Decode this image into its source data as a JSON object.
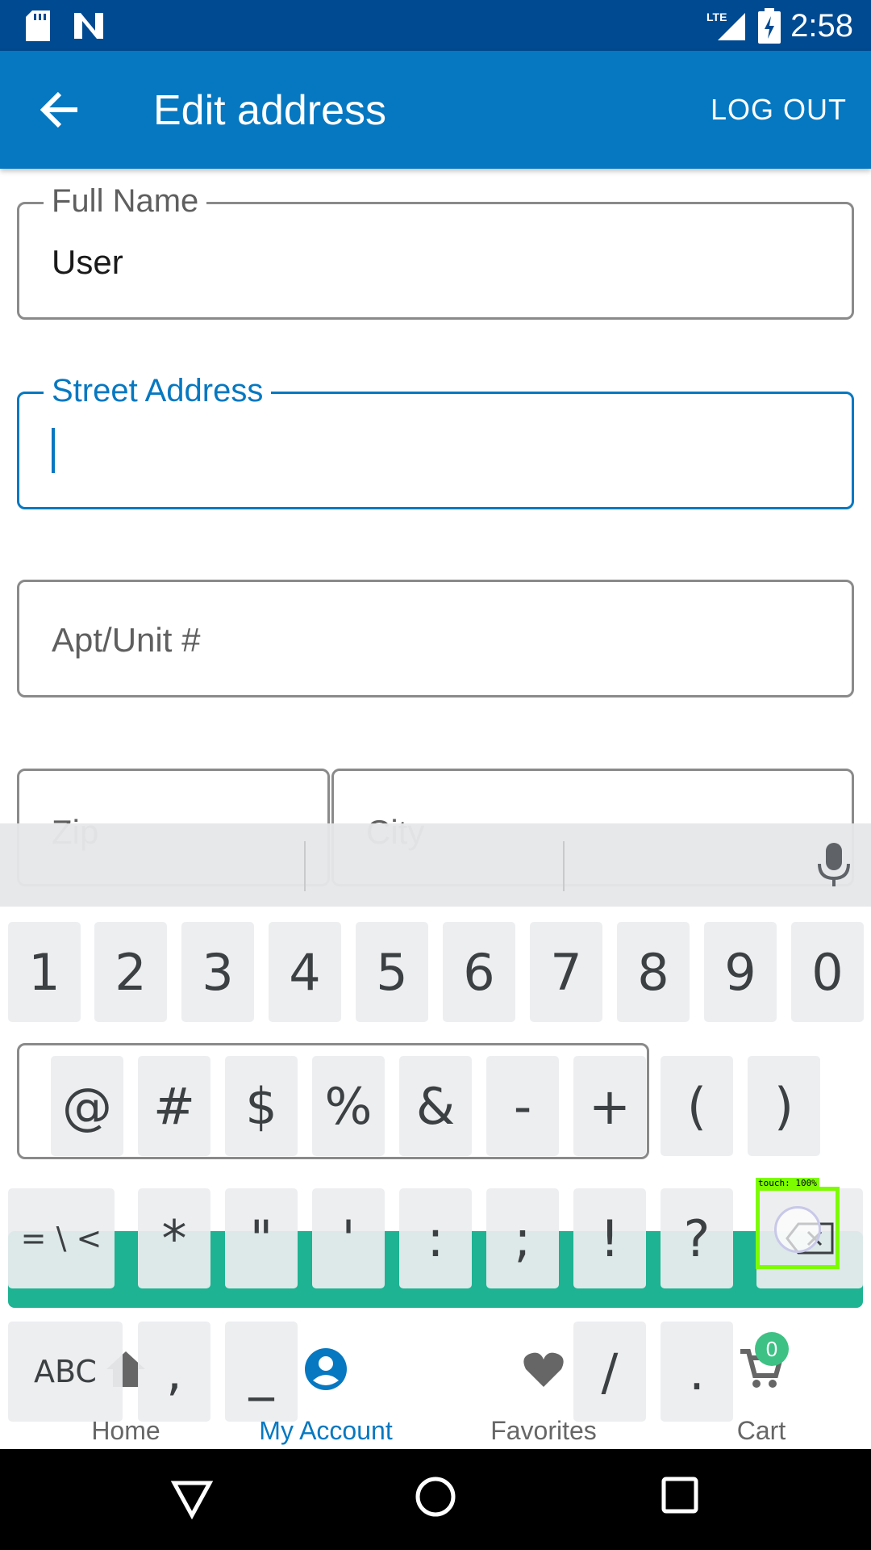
{
  "status_bar": {
    "time": "2:58",
    "network_label": "LTE",
    "icons": [
      "sd-card-icon",
      "n-notification-icon",
      "lte-signal-icon",
      "battery-charging-icon"
    ]
  },
  "app_bar": {
    "title": "Edit address",
    "logout_label": "LOG OUT",
    "back_icon": "arrow-left-icon"
  },
  "form": {
    "full_name": {
      "label": "Full Name",
      "value": "User"
    },
    "street_address": {
      "label": "Street Address",
      "value": ""
    },
    "apt_unit": {
      "placeholder": "Apt/Unit #"
    },
    "zip": {
      "placeholder_clipped": "Zip"
    },
    "city": {
      "placeholder_clipped": "City"
    }
  },
  "bottom_nav": {
    "items": [
      {
        "label": "Home",
        "icon": "home-icon",
        "active": false
      },
      {
        "label": "My Account",
        "icon": "account-icon",
        "active": true
      },
      {
        "label": "Favorites",
        "icon": "heart-icon",
        "active": false
      },
      {
        "label": "Cart",
        "icon": "cart-icon",
        "active": false
      }
    ],
    "cart_count": "0"
  },
  "keyboard": {
    "row1": [
      "1",
      "2",
      "3",
      "4",
      "5",
      "6",
      "7",
      "8",
      "9",
      "0"
    ],
    "row2": [
      "@",
      "#",
      "$",
      "%",
      "&",
      "-",
      "+",
      "(",
      ")"
    ],
    "row3": [
      "= \\ <",
      "*",
      "\"",
      "'",
      ":",
      ";",
      "!",
      "?"
    ],
    "row4": [
      "ABC",
      ",",
      "_",
      "/",
      "."
    ]
  },
  "touch_indicator": {
    "label": "touch: 100%"
  },
  "colors": {
    "status_bar": "#004a91",
    "app_bar": "#0678c1",
    "accent": "#0678c1",
    "save_bar": "#1db393",
    "cart_badge": "#3ec184",
    "touch_highlight": "#7dfc00"
  }
}
